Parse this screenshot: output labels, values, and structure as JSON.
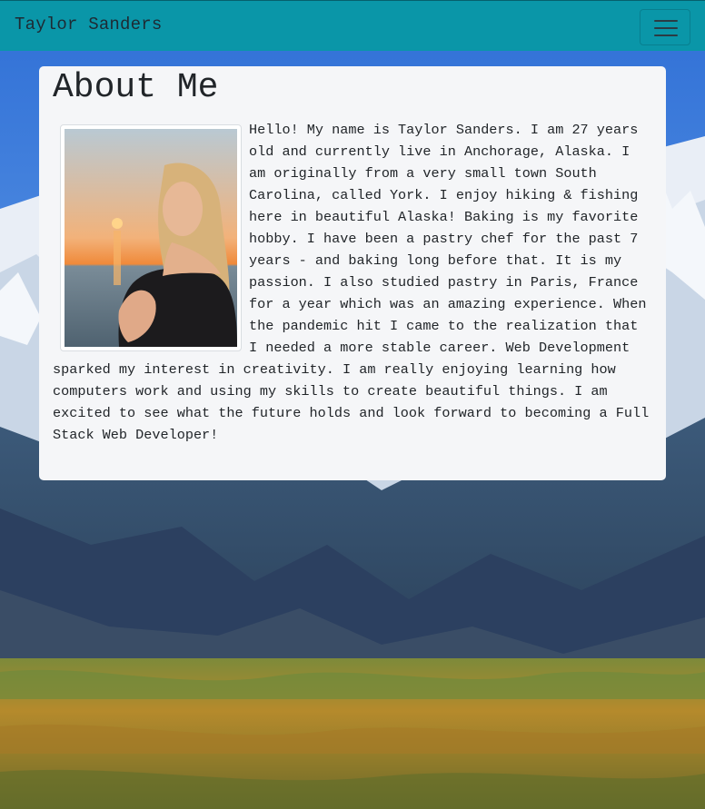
{
  "navbar": {
    "brand": "Taylor Sanders",
    "toggle_icon": "hamburger-menu-icon",
    "color": "#0a96a8"
  },
  "about": {
    "heading": "About Me",
    "photo_alt": "profile-photo",
    "bio": "Hello! My name is Taylor Sanders. I am 27 years old and currently live in Anchorage, Alaska. I am originally from a very small town South Carolina, called York. I enjoy hiking & fishing here in beautiful Alaska! Baking is my favorite hobby. I have been a pastry chef for the past 7 years - and baking long before that. It is my passion. I also studied pastry in Paris, France for a year which was an amazing experience. When the pandemic hit I came to the realization that I needed a more stable career. Web Development sparked my interest in creativity. I am really enjoying learning how computers work and using my skills to create beautiful things. I am excited to see what the future holds and look forward to becoming a Full Stack Web Developer!"
  }
}
